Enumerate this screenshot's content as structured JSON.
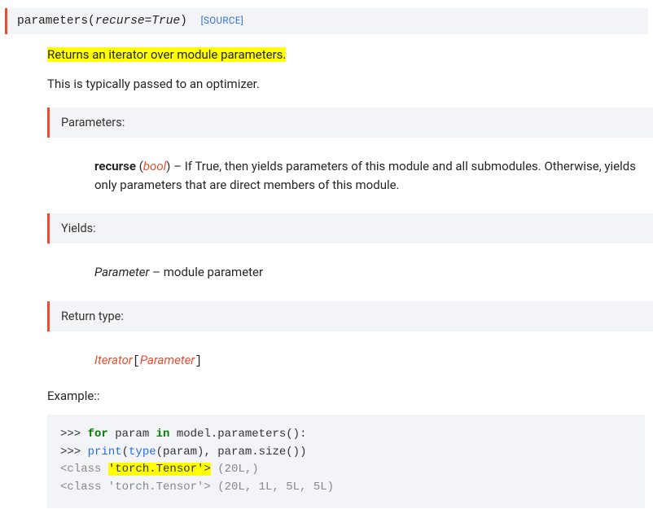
{
  "signature": {
    "name": "parameters",
    "open": "(",
    "param_name": "recurse",
    "eq": "=",
    "param_val": "True",
    "close": ")",
    "source": "[SOURCE]"
  },
  "summary": "Returns an iterator over module parameters.",
  "description": "This is typically passed to an optimizer.",
  "params": {
    "label": "Parameters:",
    "name": "recurse",
    "type_open": " (",
    "type": "bool",
    "type_close": ") ",
    "dash": "– ",
    "text": "If True, then yields parameters of this module and all submodules. Otherwise, yields only parameters that are direct members of this module."
  },
  "yields": {
    "label": "Yields:",
    "name": "Parameter",
    "dash": " – ",
    "text": "module parameter"
  },
  "rtype": {
    "label": "Return type:",
    "outer": "Iterator",
    "open": "[",
    "inner": "Parameter",
    "close": "]"
  },
  "example": {
    "label": "Example::",
    "l1_prompt": ">>> ",
    "l1_kw1": "for",
    "l1_mid": " param ",
    "l1_kw2": "in",
    "l1_rest": " model.parameters():",
    "l2_prompt": ">>>     ",
    "l2_builtin1": "print",
    "l2_open": "(",
    "l2_builtin2": "type",
    "l2_rest": "(param), param.size())",
    "l3_pre": "<class ",
    "l3_hl": "'torch.Tensor'>",
    "l3_post": " (20L,)",
    "l4": "<class 'torch.Tensor'> (20L, 1L, 5L, 5L)"
  }
}
